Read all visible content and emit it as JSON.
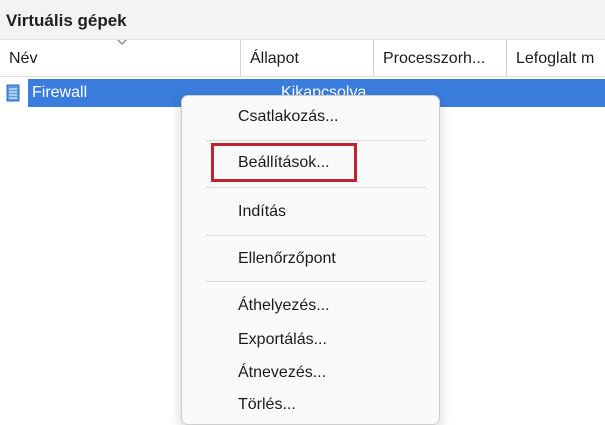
{
  "panel": {
    "title": "Virtuális gépek"
  },
  "columns": [
    "Név",
    "Állapot",
    "Processzorh...",
    "Lefoglalt m"
  ],
  "row": {
    "name": "Firewall",
    "state": "Kikapcsolva"
  },
  "menu": {
    "items": [
      "Csatlakozás...",
      "Beállítások...",
      "Indítás",
      "Ellenőrzőpont",
      "Áthelyezés...",
      "Exportálás...",
      "Átnevezés...",
      "Törlés..."
    ],
    "highlighted_item": "Beállítások..."
  },
  "colors": {
    "selection": "#3b7ddd",
    "highlight_border": "#c0232b",
    "header_bg": "#f3f3f3",
    "menu_bg": "#f9f9f9"
  }
}
